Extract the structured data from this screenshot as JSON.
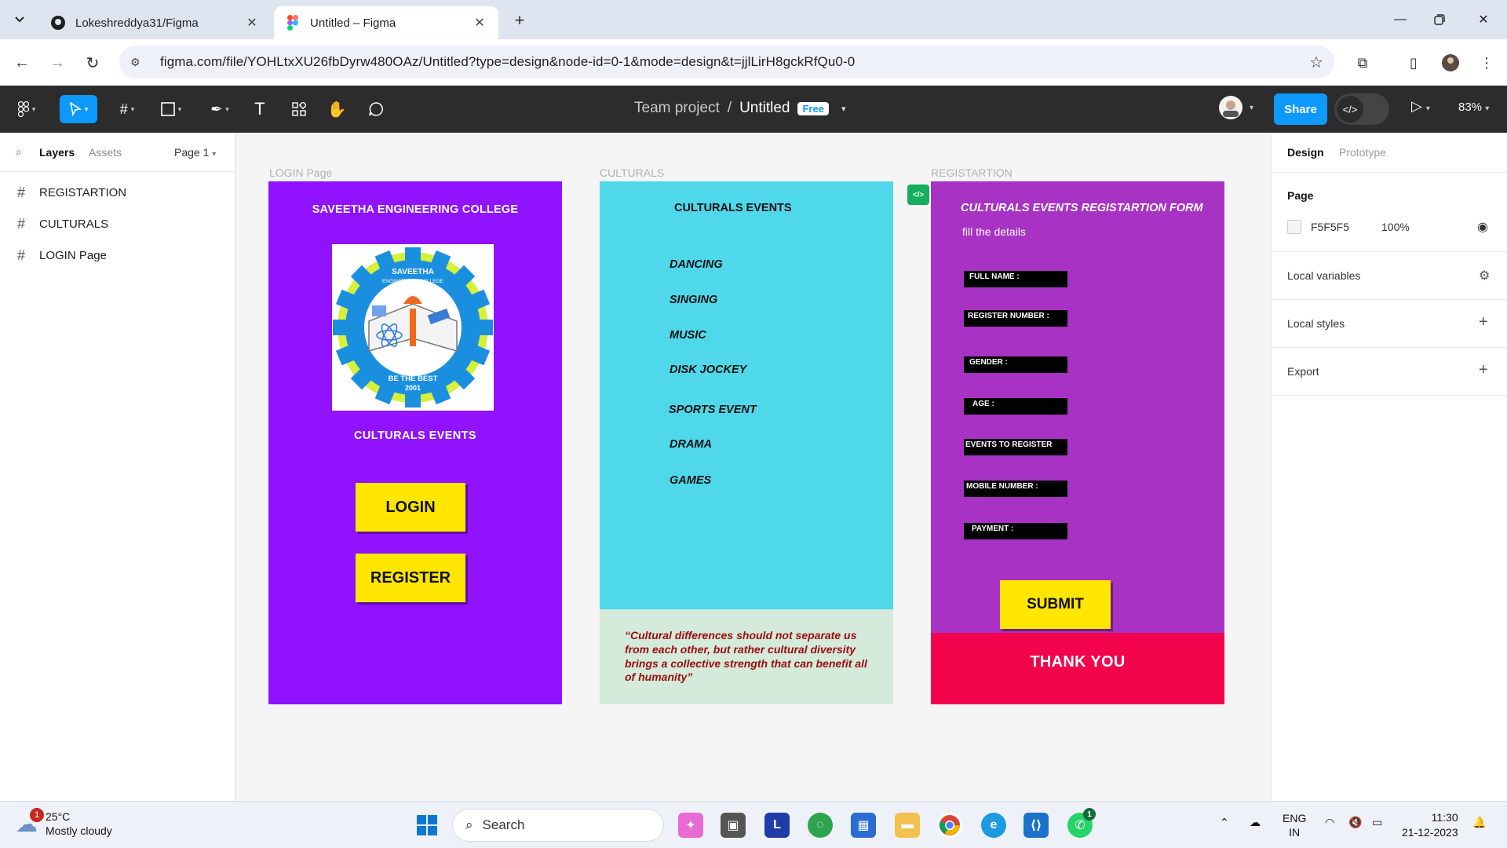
{
  "browser": {
    "tabs": [
      {
        "title": "Lokeshreddya31/Figma",
        "icon": "github-icon",
        "active": false
      },
      {
        "title": "Untitled – Figma",
        "icon": "figma-icon",
        "active": true
      }
    ],
    "url": "figma.com/file/YOHLtxXU26fbDyrw480OAz/Untitled?type=design&node-id=0-1&mode=design&t=jjlLirH8gckRfQu0-0"
  },
  "figma": {
    "toolbar": {
      "tools": [
        "main-menu",
        "move",
        "frame",
        "shape",
        "pen",
        "text",
        "resources",
        "hand",
        "comment"
      ],
      "breadcrumb_project": "Team project",
      "breadcrumb_sep": "/",
      "file_name": "Untitled",
      "plan_badge": "Free",
      "share_label": "Share",
      "zoom": "83%",
      "accent": "#0d99ff"
    },
    "left_panel": {
      "tab_layers": "Layers",
      "tab_assets": "Assets",
      "page_selector": "Page 1",
      "layers": [
        {
          "name": "REGISTARTION"
        },
        {
          "name": "CULTURALS"
        },
        {
          "name": "LOGIN Page"
        }
      ]
    },
    "canvas": {
      "frames": {
        "login": {
          "label": "LOGIN Page",
          "college": "SAVEETHA ENGINEERING COLLEGE",
          "logo_top": "SAVEETHA",
          "logo_sub": "ENGINEERING COLLEGE",
          "logo_motto": "BE THE BEST",
          "logo_year": "2001",
          "subtitle": "CULTURALS  EVENTS",
          "login_button": "LOGIN",
          "register_button": "REGISTER",
          "bg": "#9012fe"
        },
        "culturals": {
          "label": "CULTURALS",
          "title": "CULTURALS EVENTS",
          "events": [
            "DANCING",
            "SINGING",
            "MUSIC",
            "DISK JOCKEY",
            "SPORTS EVENT",
            "DRAMA",
            "GAMES"
          ],
          "quote": "“Cultural differences should not separate us from each other, but rather cultural diversity brings a collective strength that can benefit all of humanity”",
          "bg": "#4fd7ea"
        },
        "registration": {
          "label": "REGISTARTION",
          "title": "CULTURALS EVENTS REGISTARTION FORM",
          "subtitle": "fill the details",
          "fields": [
            "FULL NAME :",
            "REGISTER NUMBER :",
            "GENDER  :",
            "AGE :",
            "EVENTS TO REGISTER",
            "MOBILE NUMBER :",
            "PAYMENT :"
          ],
          "submit_button": "SUBMIT",
          "thank_you": "THANK YOU",
          "bg": "#a832c4"
        }
      },
      "help": "?"
    },
    "right_panel": {
      "tab_design": "Design",
      "tab_prototype": "Prototype",
      "page_heading": "Page",
      "page_color": "F5F5F5",
      "page_opacity": "100%",
      "local_variables": "Local variables",
      "local_styles": "Local styles",
      "export": "Export"
    }
  },
  "taskbar": {
    "weather_temp": "25°C",
    "weather_desc": "Mostly cloudy",
    "weather_badge": "1",
    "search_label": "Search",
    "lang_top": "ENG",
    "lang_bottom": "IN",
    "time": "11:30",
    "date": "21-12-2023",
    "whatsapp_badge": "1"
  }
}
